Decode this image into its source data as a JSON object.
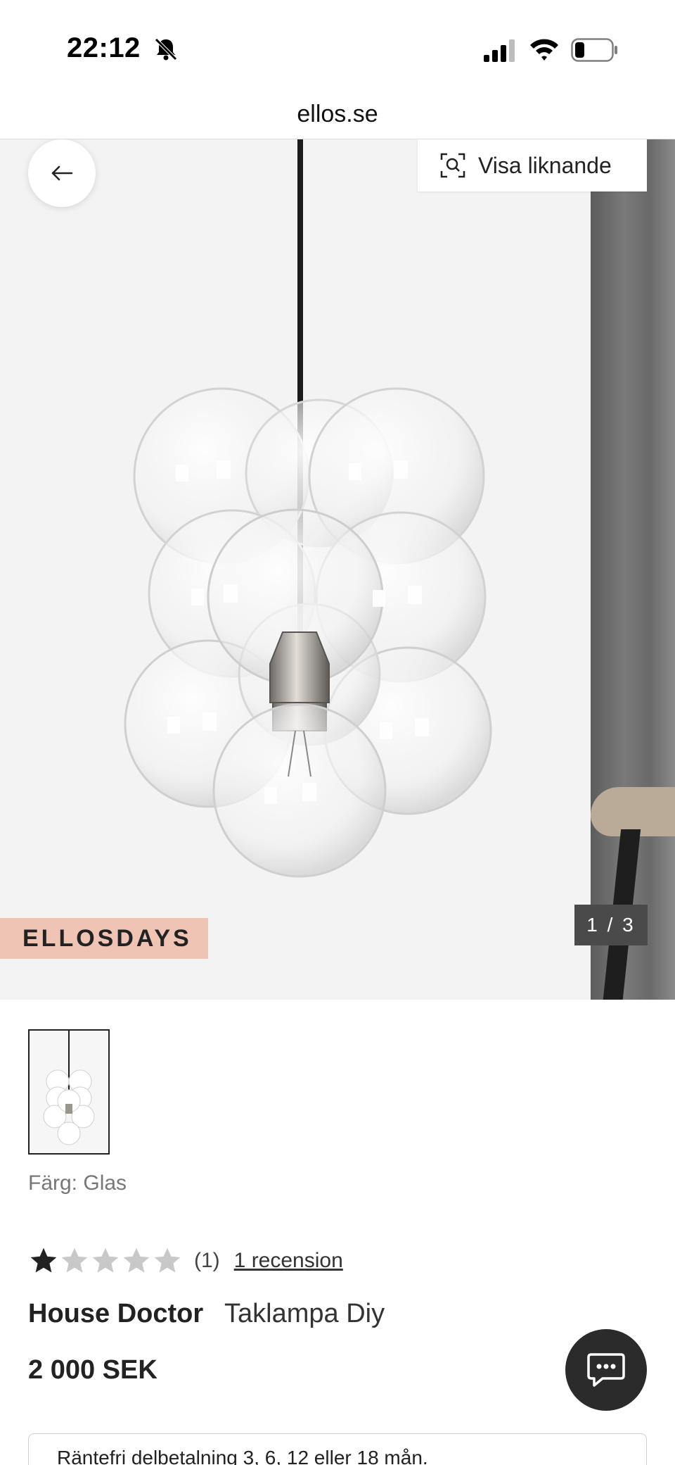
{
  "status_bar": {
    "time": "22:12"
  },
  "browser": {
    "url": "ellos.se"
  },
  "hero": {
    "similar_label": "Visa liknande",
    "promo_badge": "ELLOSDAYS",
    "counter": "1 / 3"
  },
  "product": {
    "color_label": "Färg:",
    "color_value": "Glas",
    "rating_value": 1,
    "rating_max": 5,
    "rating_count": "(1)",
    "review_link": "1 recension",
    "brand": "House Doctor",
    "name": "Taklampa Diy",
    "price": "2 000 SEK"
  },
  "installment": {
    "text": "Räntefri delbetalning 3, 6, 12 eller 18 mån."
  },
  "colors": {
    "promo_bg": "#f0c4b4",
    "chat_bg": "#2b2b2b",
    "counter_bg": "#4a4a4a",
    "star_filled": "#222222",
    "star_empty": "#c8c8c8"
  }
}
